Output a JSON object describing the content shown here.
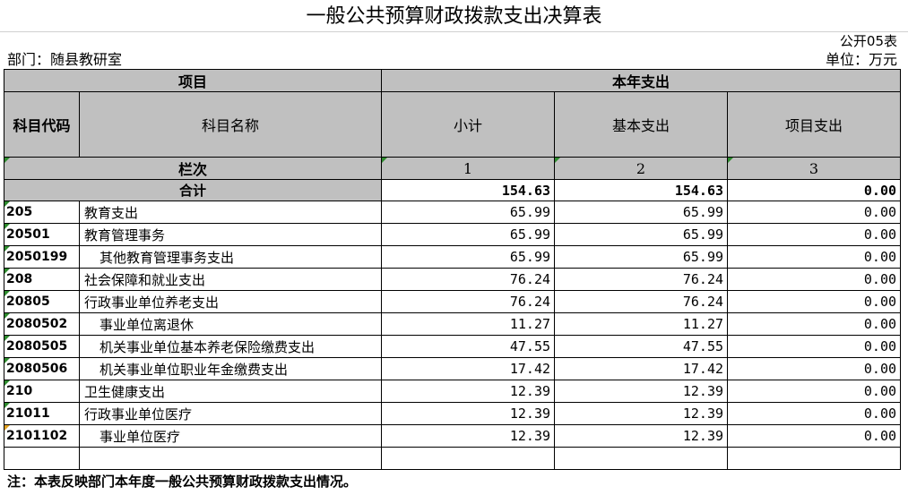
{
  "title": "一般公共预算财政拨款支出决算表",
  "table_no": "公开05表",
  "department": "部门：随县教研室",
  "unit": "单位：万元",
  "header": {
    "project": "项目",
    "annual_expense": "本年支出",
    "code": "科目代码",
    "name": "科目名称",
    "subtotal": "小计",
    "basic": "基本支出",
    "project_exp": "项目支出",
    "column_label": "栏次",
    "col1": "1",
    "col2": "2",
    "col3": "3"
  },
  "total": {
    "label": "合计",
    "subtotal": "154.63",
    "basic": "154.63",
    "project": "0.00"
  },
  "rows": [
    {
      "code": "205",
      "name": "教育支出",
      "subtotal": "65.99",
      "basic": "65.99",
      "project": "0.00"
    },
    {
      "code": "20501",
      "name": "教育管理事务",
      "subtotal": "65.99",
      "basic": "65.99",
      "project": "0.00"
    },
    {
      "code": "2050199",
      "name": "其他教育管理事务支出",
      "subtotal": "65.99",
      "basic": "65.99",
      "project": "0.00"
    },
    {
      "code": "208",
      "name": "社会保障和就业支出",
      "subtotal": "76.24",
      "basic": "76.24",
      "project": "0.00"
    },
    {
      "code": "20805",
      "name": "行政事业单位养老支出",
      "subtotal": "76.24",
      "basic": "76.24",
      "project": "0.00"
    },
    {
      "code": "2080502",
      "name": "事业单位离退休",
      "subtotal": "11.27",
      "basic": "11.27",
      "project": "0.00"
    },
    {
      "code": "2080505",
      "name": "机关事业单位基本养老保险缴费支出",
      "subtotal": "47.55",
      "basic": "47.55",
      "project": "0.00"
    },
    {
      "code": "2080506",
      "name": "机关事业单位职业年金缴费支出",
      "subtotal": "17.42",
      "basic": "17.42",
      "project": "0.00"
    },
    {
      "code": "210",
      "name": "卫生健康支出",
      "subtotal": "12.39",
      "basic": "12.39",
      "project": "0.00"
    },
    {
      "code": "21011",
      "name": "行政事业单位医疗",
      "subtotal": "12.39",
      "basic": "12.39",
      "project": "0.00"
    },
    {
      "code": "2101102",
      "name": "事业单位医疗",
      "subtotal": "12.39",
      "basic": "12.39",
      "project": "0.00"
    }
  ],
  "note": "注：本表反映部门本年度一般公共预算财政拨款支出情况。"
}
